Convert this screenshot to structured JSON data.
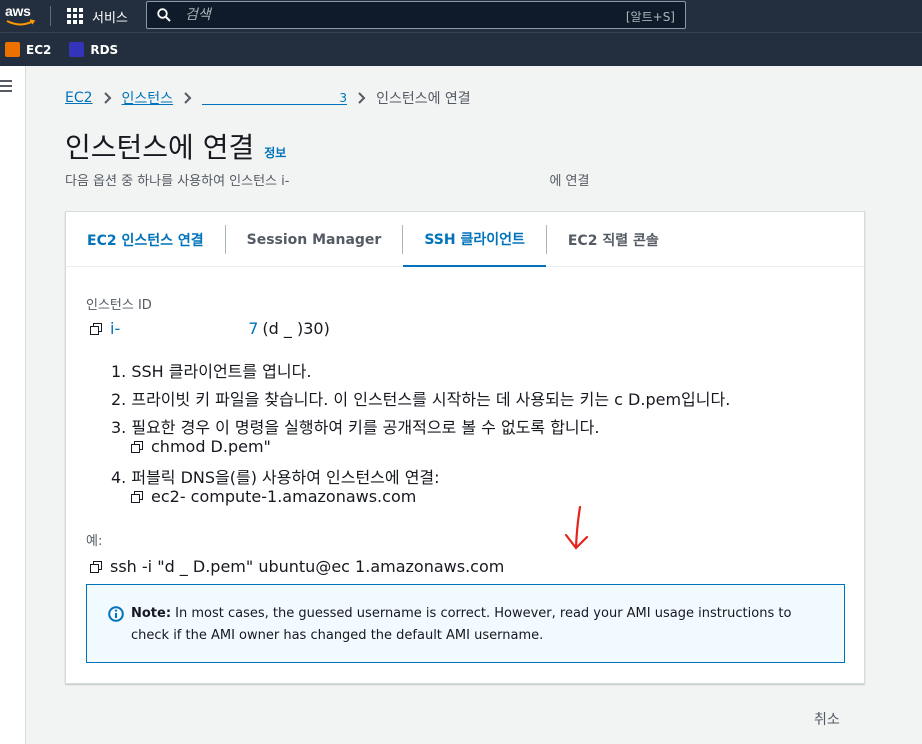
{
  "topnav": {
    "logo_text": "aws",
    "services_label": "서비스",
    "search_placeholder": "검색",
    "search_shortcut": "[알트+S]"
  },
  "favorites": [
    {
      "label": "EC2",
      "icon": "ec2-icon"
    },
    {
      "label": "RDS",
      "icon": "rds-icon"
    }
  ],
  "breadcrumb": {
    "ec2": "EC2",
    "instances": "인스턴스",
    "instance_tail": "3",
    "current": "인스턴스에 연결"
  },
  "page": {
    "title": "인스턴스에 연결",
    "info": "정보",
    "desc_start": "다음 옵션 중 하나를 사용하여 인스턴스 i-",
    "desc_end": "에 연결"
  },
  "tabs": [
    {
      "label": "EC2 인스턴스 연결"
    },
    {
      "label": "Session Manager"
    },
    {
      "label": "SSH 클라이언트"
    },
    {
      "label": "EC2 직렬 콘솔"
    }
  ],
  "ssh": {
    "instance_id_label": "인스턴스 ID",
    "instance_id_value": "i-",
    "instance_id_tail": "7",
    "instance_name": "(d       _       )30)",
    "steps": {
      "s1": "1. SSH 클라이언트를 엽니다.",
      "s2": "2. 프라이빗 키 파일을 찾습니다. 이 인스턴스를 시작하는 데 사용되는 키는 c                    D.pem입니다.",
      "s3": "3. 필요한 경우 이 명령을 실행하여 키를 공개적으로 볼 수 없도록 합니다.",
      "s3_cmd": "chmod                        D.pem\"",
      "s4": "4. 퍼블릭 DNS을(를) 사용하여 인스턴스에 연결:",
      "s4_cmd": "ec2-                      compute-1.amazonaws.com"
    },
    "example_label": "예:",
    "example_cmd": "ssh -i \"d        _        D.pem\" ubuntu@ec                                         1.amazonaws.com",
    "note_bold": "Note:",
    "note_text": " In most cases, the guessed username is correct. However, read your AMI usage instructions to check if the AMI owner has changed the default AMI username."
  },
  "footer": {
    "cancel_label": "취소"
  },
  "colors": {
    "nav_bg": "#232f3e",
    "link": "#0073bb",
    "note_bg": "#f1faff",
    "ec2_orange": "#ed7100",
    "rds_blue": "#3334b9",
    "annotation_red": "#e3241b"
  }
}
